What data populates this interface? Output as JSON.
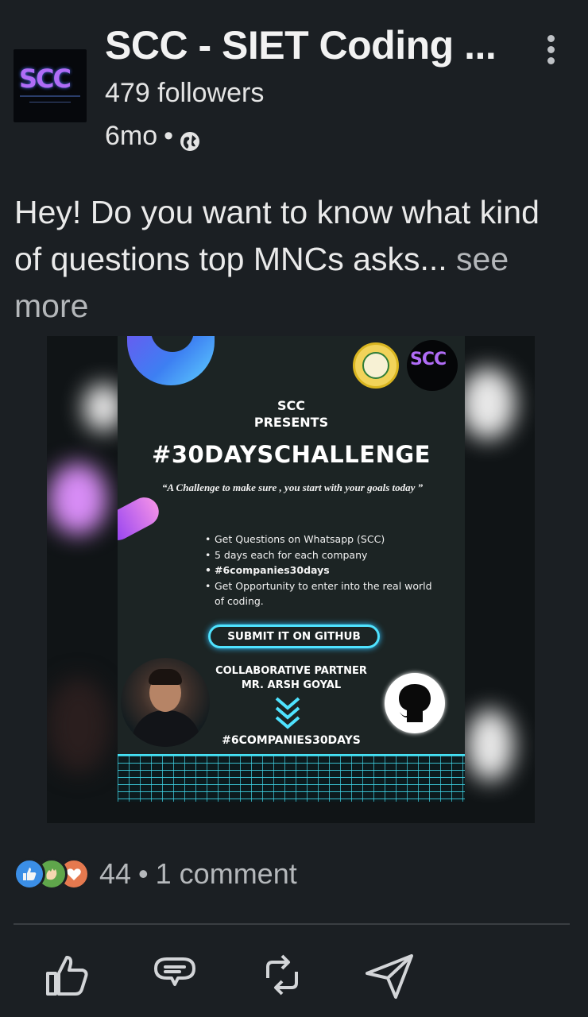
{
  "post": {
    "author": {
      "name": "SCC - SIET Coding ...",
      "followers": "479 followers",
      "time": "6mo",
      "separator": "•",
      "avatar_text": "SCC",
      "visibility_icon": "globe-icon"
    },
    "menu_icon": "more-vertical-icon",
    "text": "Hey! Do you want to know what kind of questions top MNCs asks...",
    "see_more": "see more",
    "image": {
      "heading_scc": "SCC",
      "heading_presents": "PRESENTS",
      "challenge": "#30DAYSCHALLENGE",
      "quote": "“A Challenge to make sure , you start with your goals today ”",
      "bullets": [
        "Get Questions on Whatsapp (SCC)",
        "5 days each for each company",
        "#6companies30days",
        "Get Opportunity to enter into the real world of coding."
      ],
      "submit_button": "SUBMIT IT ON GITHUB",
      "collab_label": "COLLABORATIVE  PARTNER",
      "partner_name": "MR. ARSH GOYAL",
      "hashtag": "#6COMPANIES30DAYS",
      "badge_scc": "SCC"
    }
  },
  "engagement": {
    "reaction_icons": [
      "like-icon",
      "celebrate-icon",
      "love-icon"
    ],
    "reaction_count": "44",
    "separator": "•",
    "comments": "1 comment"
  },
  "actions": {
    "icons": [
      "like-icon",
      "comment-icon",
      "repost-icon",
      "send-icon"
    ]
  },
  "colors": {
    "background": "#1b1f23",
    "text": "#e9e9e9",
    "muted": "#b5b8bb",
    "neon_accent": "#4fe3ff",
    "like_blue": "#3b8ee6",
    "celebrate_green": "#5fa64b",
    "love_orange": "#e5794f"
  }
}
